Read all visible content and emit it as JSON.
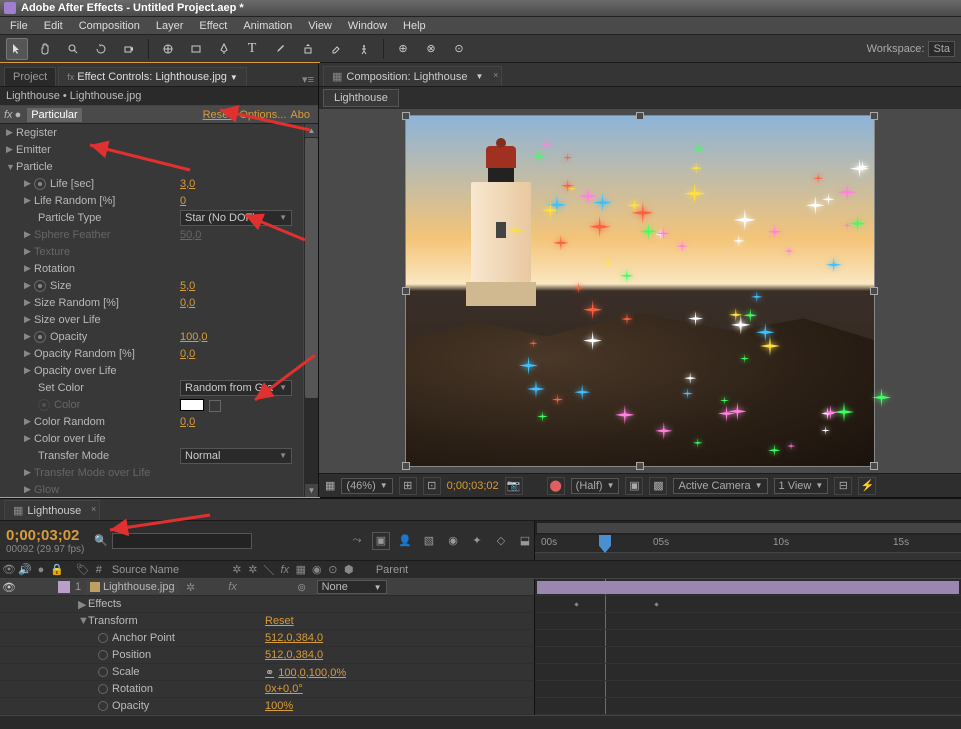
{
  "title": "Adobe After Effects - Untitled Project.aep *",
  "menu": [
    "File",
    "Edit",
    "Composition",
    "Layer",
    "Effect",
    "Animation",
    "View",
    "Window",
    "Help"
  ],
  "workspace": {
    "label": "Workspace:",
    "value": "Sta"
  },
  "tabs": {
    "project": "Project",
    "effect_controls": "Effect Controls: Lighthouse.jpg"
  },
  "breadcrumb": "Lighthouse • Lighthouse.jpg",
  "fx": {
    "name": "Particular",
    "reset": "Reset",
    "options": "Options...",
    "about": "Abo"
  },
  "props": {
    "register": "Register",
    "emitter": "Emitter",
    "particle": "Particle",
    "life": {
      "label": "Life [sec]",
      "val": "3,0"
    },
    "life_random": {
      "label": "Life Random [%]",
      "val": "0"
    },
    "ptype": {
      "label": "Particle Type",
      "val": "Star (No DOF)"
    },
    "sphere_feather": {
      "label": "Sphere Feather",
      "val": "50,0"
    },
    "texture": "Texture",
    "rotation": "Rotation",
    "size": {
      "label": "Size",
      "val": "5,0"
    },
    "size_random": {
      "label": "Size Random [%]",
      "val": "0,0"
    },
    "size_over_life": "Size over Life",
    "opacity": {
      "label": "Opacity",
      "val": "100,0"
    },
    "opacity_random": {
      "label": "Opacity Random [%]",
      "val": "0,0"
    },
    "opacity_over_life": "Opacity over Life",
    "set_color": {
      "label": "Set Color",
      "val": "Random from Gra"
    },
    "color": "Color",
    "color_random": {
      "label": "Color Random",
      "val": "0,0"
    },
    "color_over_life": "Color over Life",
    "transfer_mode": {
      "label": "Transfer Mode",
      "val": "Normal"
    },
    "tm_over_life": "Transfer Mode over Life",
    "glow": "Glow"
  },
  "comp": {
    "tab": "Composition: Lighthouse",
    "layer_tab": "Lighthouse"
  },
  "viewer_bar": {
    "zoom": "(46%)",
    "time": "0;00;03;02",
    "res": "(Half)",
    "camera": "Active Camera",
    "views": "1 View"
  },
  "timeline": {
    "tab": "Lighthouse",
    "timecode": "0;00;03;02",
    "frames": "00092 (29.97 fps)",
    "search_placeholder": "",
    "ticks": [
      "00s",
      "05s",
      "10s",
      "15s"
    ],
    "cols": {
      "source": "Source Name",
      "parent": "Parent"
    },
    "layer": {
      "num": "1",
      "name": "Lighthouse.jpg",
      "parent": "None"
    },
    "effects": "Effects",
    "transform": "Transform",
    "reset": "Reset",
    "anchor": {
      "label": "Anchor Point",
      "val": "512,0,384,0"
    },
    "position": {
      "label": "Position",
      "val": "512,0,384,0"
    },
    "scale": {
      "label": "Scale",
      "val": "100,0,100,0%",
      "link": "⚭"
    },
    "rotation": {
      "label": "Rotation",
      "val": "0x+0,0°"
    },
    "opacity": {
      "label": "Opacity",
      "val": "100%"
    }
  }
}
